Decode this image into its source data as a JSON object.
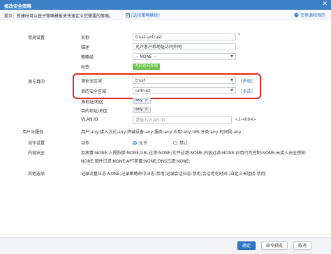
{
  "window": {
    "title": "修改安全策略",
    "close": "✕"
  },
  "hint": {
    "text": "提示：新建时可以基于策略模板来快速定义您需要的策略。",
    "link": "[选择策略模板]",
    "switch": "交换源和目的"
  },
  "sections": {
    "basic": "常规设置",
    "src_dst": "源与目的",
    "user_service": "用户与服务",
    "action": "动作设置",
    "content_security": "内容安全",
    "other": "其他选项"
  },
  "basic": {
    "name_label": "名称",
    "name_value": "trust-untrust",
    "desc_label": "描述",
    "desc_value": "允许客户机地址访问外网",
    "group_label": "策略组",
    "group_value": "-- NONE --",
    "tag_label": "标签",
    "tag_value": "内网访问外网"
  },
  "src_dst": {
    "src_zone_label": "源安全区域",
    "src_zone_value": "trust",
    "dst_zone_label": "目的安全区域",
    "dst_zone_value": "untrust",
    "multi_select": "[多选]",
    "src_addr_label": "源地址/地区",
    "src_addr_value": "any",
    "dst_addr_label": "目的地址/地区",
    "dst_addr_value": "any",
    "vlan_label": "VLAN ID",
    "vlan_placeholder": "请输入VLAN ID",
    "vlan_range": "<1-4094>"
  },
  "user_service": {
    "summary": "用户:any;接入方式:any;终端设备:any;服务:any;应用:any;URL分类:any;时间段:any;"
  },
  "action": {
    "label": "动作",
    "allow": "允许",
    "deny": "禁止",
    "selected": "allow"
  },
  "content_security": {
    "line1": "反病毒:NONE;入侵防御:NONE;URL过滤:NONE;文件过滤:NONE;内容过滤:NONE;应用行为控制:NONE;云接入安全感知:",
    "line2": "NONE;邮件过滤:NONE;APT防御:NONE;DNS过滤:NONE;"
  },
  "other": {
    "summary": "记录流量日志:NONE;记录策略命中日志:禁用;记录会话日志:禁用;会话老化时间:;自定义长连接:禁用;"
  },
  "footer": {
    "ok": "确定",
    "preview": "命令预览",
    "cancel": "取消"
  },
  "colors": {
    "titlebar": "#3b7fc4",
    "highlight": "#e0261c",
    "link": "#2b74c7",
    "tag": "#6cc24a"
  }
}
